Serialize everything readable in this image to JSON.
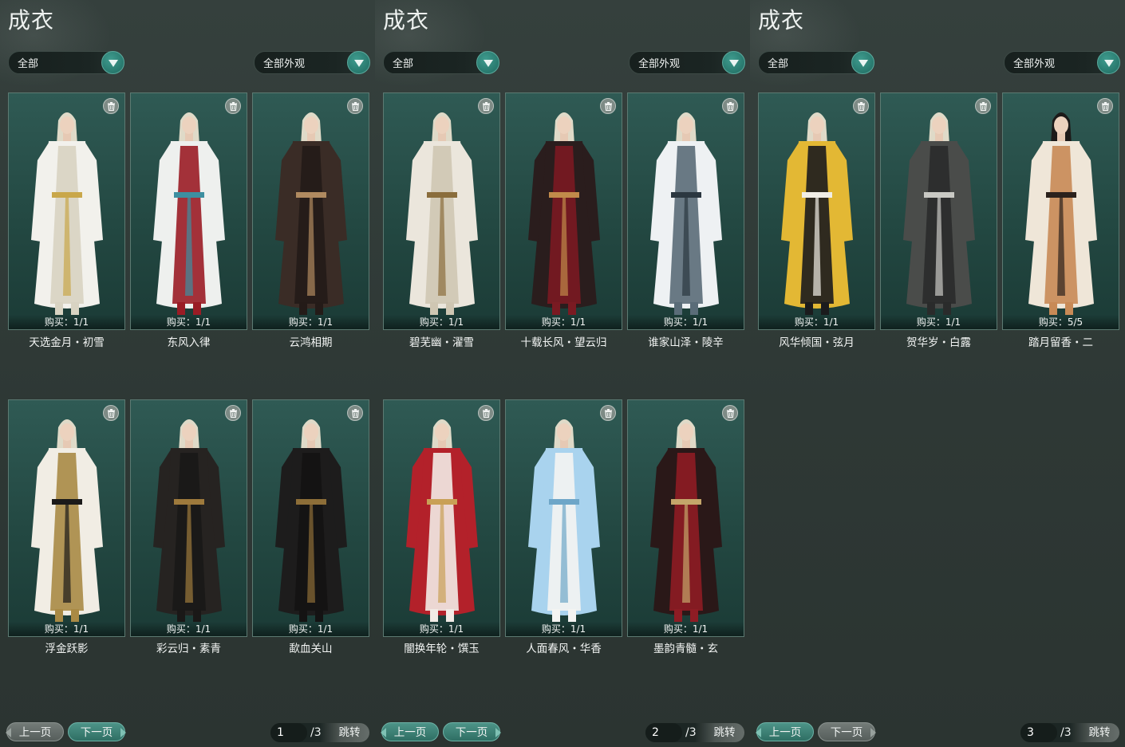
{
  "panels": [
    {
      "title": "成衣",
      "filter_left": "全部",
      "filter_right": "全部外观",
      "items": [
        {
          "buy": "购买：1/1",
          "name": "天选金月・初雪",
          "colors": [
            "#f2f1ec",
            "#d8d3c2",
            "#c9a74a"
          ]
        },
        {
          "buy": "购买：1/1",
          "name": "东风入律",
          "colors": [
            "#eef0ee",
            "#9a1c25",
            "#3d8fa0"
          ]
        },
        {
          "buy": "购买：1/1",
          "name": "云鸿相期",
          "colors": [
            "#3a2c26",
            "#241b18",
            "#b08a60"
          ]
        },
        {
          "buy": "购买：1/1",
          "name": "浮金跃影",
          "colors": [
            "#f1ede4",
            "#a98a45",
            "#1b1a1a"
          ]
        },
        {
          "buy": "购买：1/1",
          "name": "彩云归・素青",
          "colors": [
            "#262321",
            "#1a1817",
            "#9e7a3c"
          ]
        },
        {
          "buy": "购买：1/1",
          "name": "歃血关山",
          "colors": [
            "#1d1c1c",
            "#141313",
            "#8d6e38"
          ]
        }
      ],
      "pager": {
        "prev": "上一页",
        "next": "下一页",
        "page": "1",
        "total": "/3",
        "jump": "跳转"
      }
    },
    {
      "title": "成衣",
      "filter_left": "全部",
      "filter_right": "全部外观",
      "items": [
        {
          "buy": "购买：1/1",
          "name": "碧芜幽・濯雪",
          "colors": [
            "#ebe6dc",
            "#cfc6b2",
            "#8a6d3c"
          ]
        },
        {
          "buy": "购买：1/1",
          "name": "十载长风・望云归",
          "colors": [
            "#2a1d1d",
            "#7a1a22",
            "#c18a4a"
          ]
        },
        {
          "buy": "购买：1/1",
          "name": "谁家山泽・陵辛",
          "colors": [
            "#eef1f3",
            "#5a6c78",
            "#2b3740"
          ]
        },
        {
          "buy": "购买：1/1",
          "name": "闇换年轮・馔玉",
          "colors": [
            "#b3212a",
            "#f2ebe6",
            "#c9a056"
          ]
        },
        {
          "buy": "购买：1/1",
          "name": "人面春风・华香",
          "colors": [
            "#a9d3ee",
            "#f4f4f2",
            "#6ea6c8"
          ]
        },
        {
          "buy": "购买：1/1",
          "name": "墨韵青髓・玄",
          "colors": [
            "#2a1818",
            "#8e1c24",
            "#c4a56a"
          ]
        }
      ],
      "pager": {
        "prev": "上一页",
        "next": "下一页",
        "page": "2",
        "total": "/3",
        "jump": "跳转"
      }
    },
    {
      "title": "成衣",
      "filter_left": "全部",
      "filter_right": "全部外观",
      "items": [
        {
          "buy": "购买：1/1",
          "name": "风华倾国・弦月",
          "colors": [
            "#e3b834",
            "#1b1b1d",
            "#f1eee6"
          ]
        },
        {
          "buy": "购买：1/1",
          "name": "贺华岁・白露",
          "colors": [
            "#4a4c4a",
            "#2a2b2b",
            "#c9c9c4"
          ]
        },
        {
          "buy": "购买：5/5",
          "name": "踏月留香・二",
          "colors": [
            "#efe6d8",
            "#c88a56",
            "#2b211c"
          ]
        }
      ],
      "pager": {
        "prev": "上一页",
        "next": "下一页",
        "page": "3",
        "total": "/3",
        "jump": "跳转"
      }
    }
  ],
  "icons": {
    "dropdown": "chevron-down-icon",
    "trash": "trash-icon"
  },
  "accent_color": "#2f8a7c"
}
